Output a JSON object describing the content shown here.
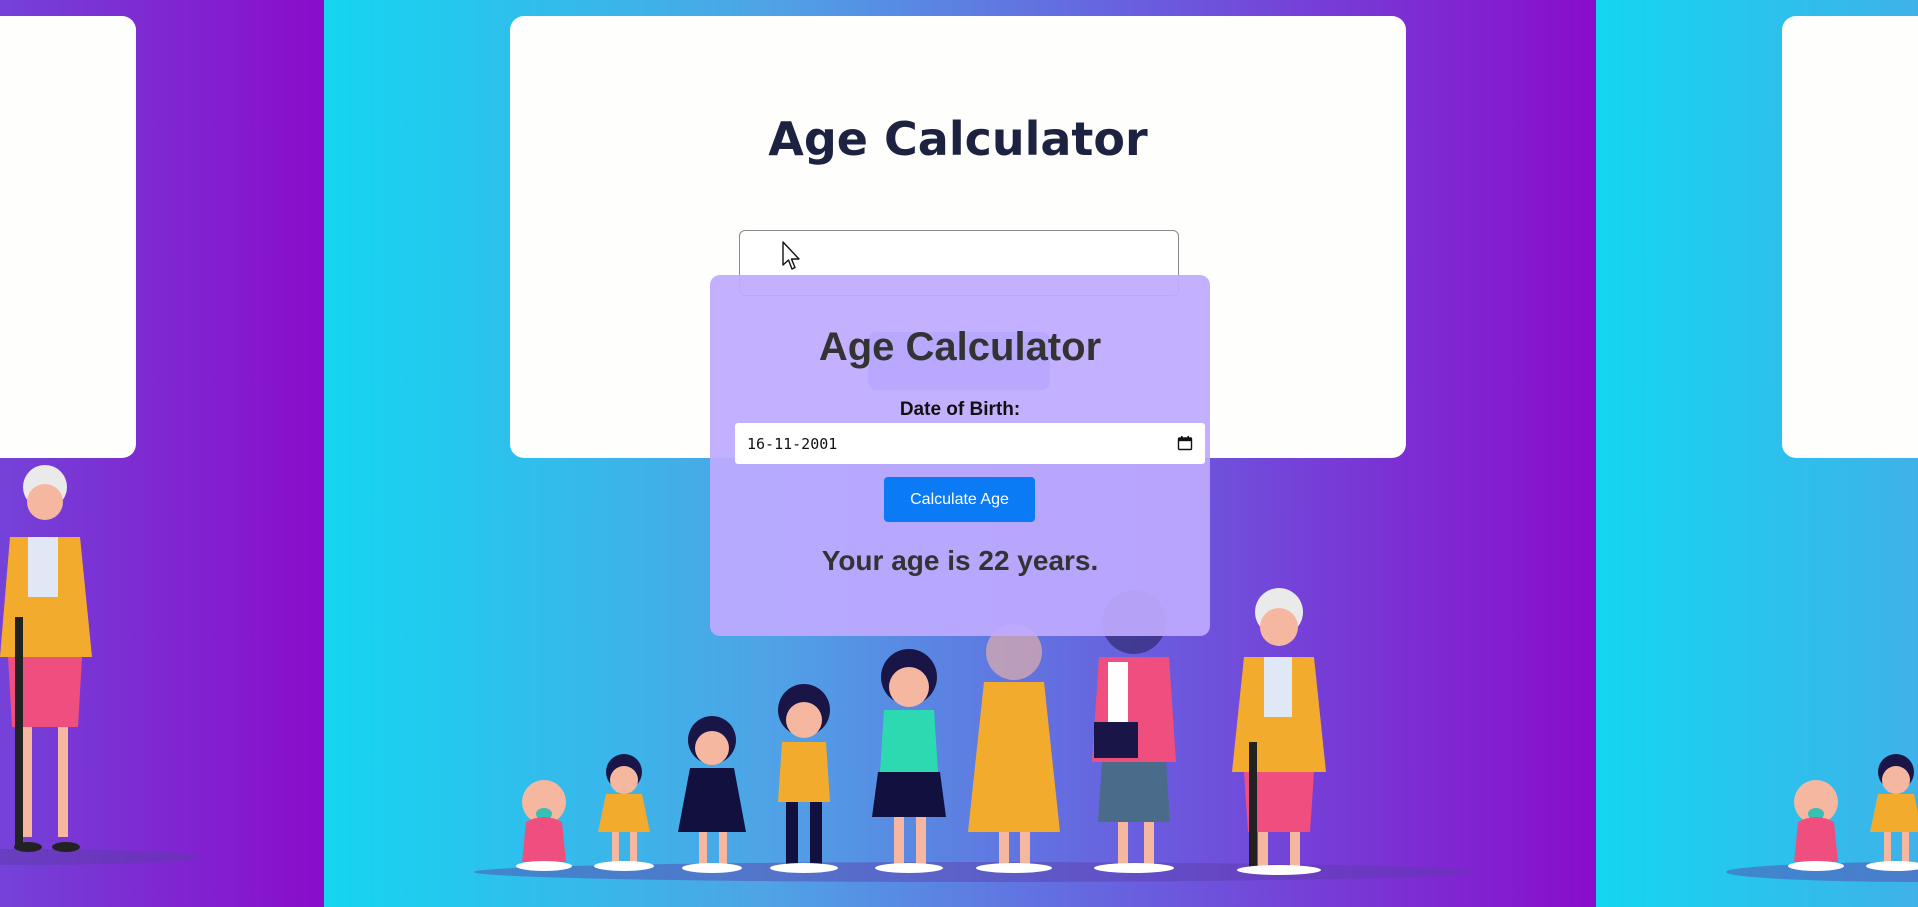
{
  "background": {
    "title": "Age Calculator",
    "colors": {
      "gradient_start": "#14d6f1",
      "gradient_end": "#8a0ccb",
      "card": "#fefefc"
    }
  },
  "modal": {
    "title": "Age Calculator",
    "dob_label": "Date of Birth:",
    "dob_value": "16-11-2001",
    "calculate_button": "Calculate Age",
    "result_text": "Your age is 22 years.",
    "calendar_icon": "calendar-icon",
    "colors": {
      "panel": "#bea9ff",
      "button": "#0b7bf5"
    }
  },
  "cursor": {
    "icon": "mouse-pointer-icon"
  }
}
